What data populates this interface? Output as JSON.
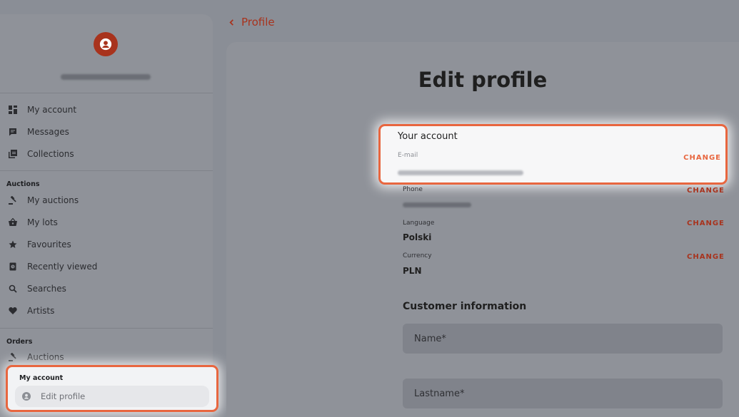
{
  "header": {
    "back_label": "Profile"
  },
  "sidebar": {
    "items_top": [
      {
        "label": "My account",
        "icon": "dashboard-icon"
      },
      {
        "label": "Messages",
        "icon": "message-icon"
      },
      {
        "label": "Collections",
        "icon": "collections-icon"
      }
    ],
    "auctions_title": "Auctions",
    "auction_items": [
      {
        "label": "My auctions",
        "icon": "gavel-icon"
      },
      {
        "label": "My lots",
        "icon": "basket-icon"
      },
      {
        "label": "Favourites",
        "icon": "star-icon"
      },
      {
        "label": "Recently viewed",
        "icon": "history-icon"
      },
      {
        "label": "Searches",
        "icon": "search-icon"
      },
      {
        "label": "Artists",
        "icon": "heart-icon"
      }
    ],
    "orders_title": "Orders",
    "order_items": [
      {
        "label": "Auctions",
        "icon": "gavel-icon"
      }
    ],
    "account_title": "My account",
    "account_items": [
      {
        "label": "Edit profile",
        "icon": "person-icon"
      }
    ]
  },
  "main": {
    "title": "Edit profile",
    "your_account": {
      "title": "Your account",
      "email_label": "E-mail",
      "change_label": "CHANGE"
    },
    "fields": [
      {
        "label": "Phone",
        "value": "",
        "change": "CHANGE"
      },
      {
        "label": "Language",
        "value": "Polski",
        "change": "CHANGE"
      },
      {
        "label": "Currency",
        "value": "PLN",
        "change": "CHANGE"
      }
    ],
    "customer_info_title": "Customer information",
    "inputs": [
      {
        "placeholder": "Name*"
      },
      {
        "placeholder": "Lastname*"
      }
    ]
  },
  "colors": {
    "accent": "#a8331d",
    "highlight": "#e8663f"
  }
}
